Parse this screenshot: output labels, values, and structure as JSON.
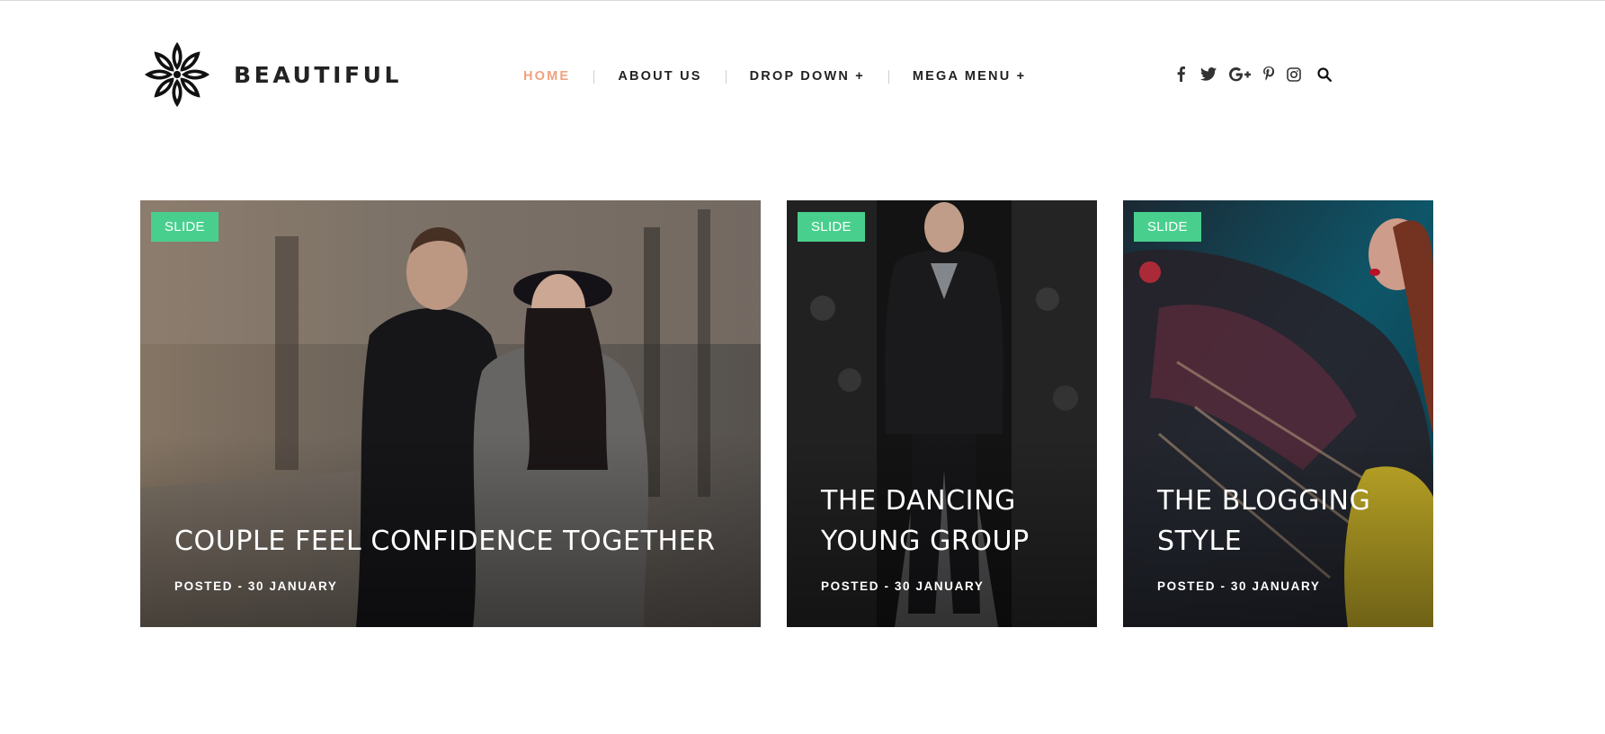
{
  "brand": {
    "name": "BEAUTIFUL",
    "logo_icon": "flower-mandala-icon"
  },
  "nav": {
    "items": [
      {
        "label": "HOME",
        "active": true
      },
      {
        "label": "ABOUT US",
        "active": false
      },
      {
        "label": "DROP DOWN +",
        "active": false
      },
      {
        "label": "MEGA MENU +",
        "active": false
      }
    ]
  },
  "social": {
    "icons": [
      "facebook-icon",
      "twitter-icon",
      "google-plus-icon",
      "pinterest-icon",
      "instagram-icon",
      "search-icon"
    ]
  },
  "posts": [
    {
      "badge": "SLIDE",
      "title": "COUPLE FEEL CONFIDENCE TOGETHER",
      "meta": "POSTED - 30 JANUARY"
    },
    {
      "badge": "SLIDE",
      "title": "THE DANCING YOUNG GROUP",
      "meta": "POSTED - 30 JANUARY"
    },
    {
      "badge": "SLIDE",
      "title": "THE BLOGGING STYLE",
      "meta": "POSTED - 30 JANUARY"
    }
  ],
  "colors": {
    "accent": "#f0a17d",
    "badge": "#49cf8d",
    "text": "#222222"
  }
}
